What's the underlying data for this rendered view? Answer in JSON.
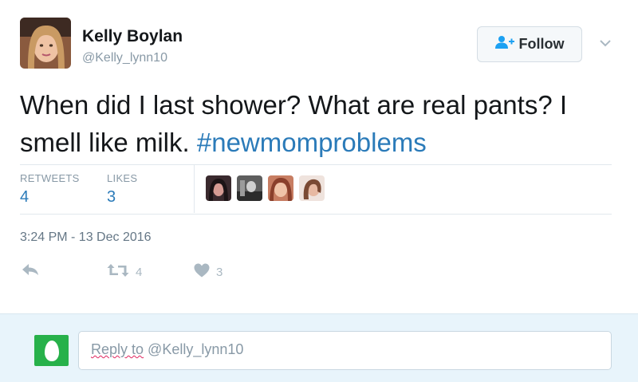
{
  "author": {
    "name": "Kelly Boylan",
    "handle": "@Kelly_lynn10",
    "avatar_icon": "profile-photo"
  },
  "follow": {
    "label": "Follow",
    "icon": "add-user-icon"
  },
  "tweet": {
    "text": "When did I last shower? What are real pants? I smell like milk. ",
    "hashtag": "#newmomproblems"
  },
  "stats": {
    "retweets_label": "RETWEETS",
    "retweets_value": "4",
    "likes_label": "LIKES",
    "likes_value": "3"
  },
  "timestamp": "3:24 PM - 13 Dec 2016",
  "actions": {
    "reply_icon": "reply-icon",
    "retweet_icon": "retweet-icon",
    "retweet_count": "4",
    "like_icon": "heart-icon",
    "like_count": "3"
  },
  "reply": {
    "prefix": "Reply to",
    "target": " @Kelly_lynn10"
  },
  "colors": {
    "link": "#2b7bb9",
    "muted": "#8899a6",
    "reply_bg": "#e8f4fb",
    "egg_avatar": "#27b14a"
  }
}
